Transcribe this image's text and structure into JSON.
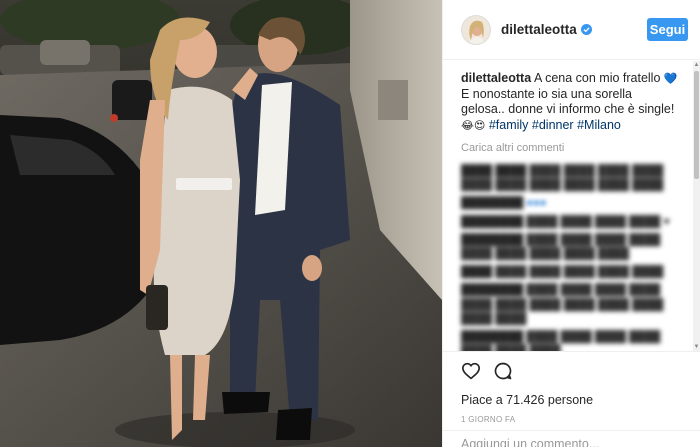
{
  "post": {
    "username": "dilettaleotta",
    "verified_icon": "verified-badge-icon",
    "follow_label": "Segui",
    "caption": {
      "text": "A cena con mio fratello",
      "heart_emoji": "💙",
      "text2": "E nonostante io sia una sorella gelosa.. donne vi informo che è single!",
      "emojis": "😂😍",
      "hashtags": [
        "#family",
        "#dinner",
        "#Milano"
      ]
    },
    "load_more_label": "Carica altri commenti",
    "likes_text": "Piace a 71.426 persone",
    "time_ago": "1 GIORNO FA",
    "comment_placeholder": "Aggiungi un commento..."
  },
  "colors": {
    "accent": "#3897f0",
    "hashtag": "#003569",
    "muted": "#999999",
    "photo_bg": "#2a2724"
  },
  "icons": {
    "like": "heart-outline-icon",
    "comment": "speech-bubble-icon"
  }
}
